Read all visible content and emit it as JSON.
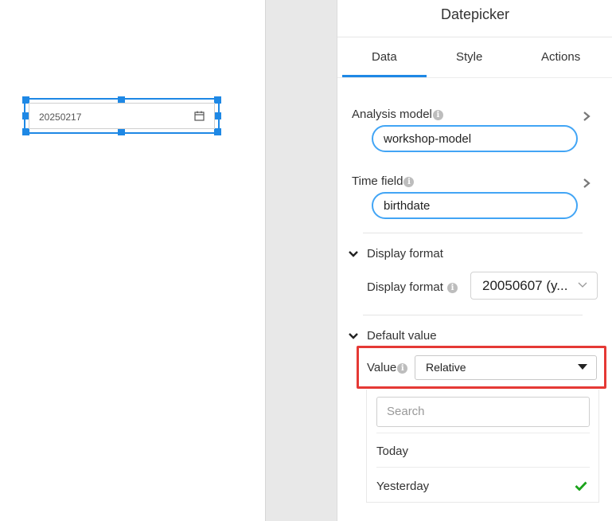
{
  "canvas": {
    "widget": {
      "value": "20250217",
      "icon": "calendar-icon"
    }
  },
  "panel": {
    "title": "Datepicker",
    "tabs": [
      {
        "label": "Data",
        "active": true
      },
      {
        "label": "Style",
        "active": false
      },
      {
        "label": "Actions",
        "active": false
      }
    ],
    "analysis_model": {
      "label": "Analysis model",
      "value": "workshop-model"
    },
    "time_field": {
      "label": "Time field",
      "value": "birthdate"
    },
    "display_format_section": {
      "heading": "Display format",
      "field_label": "Display format",
      "value": "20050607 (y..."
    },
    "default_value_section": {
      "heading": "Default value",
      "field_label": "Value",
      "selected": "Relative",
      "search_placeholder": "Search",
      "options": [
        {
          "label": "Today",
          "checked": false
        },
        {
          "label": "Yesterday",
          "checked": true
        }
      ]
    }
  },
  "colors": {
    "accent": "#1e88e5",
    "highlight": "#e53935",
    "check": "#1aa31a"
  }
}
